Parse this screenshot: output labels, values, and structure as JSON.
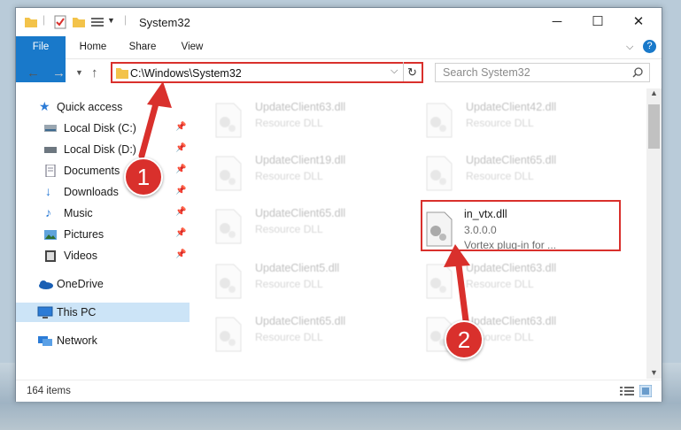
{
  "window": {
    "title": "System32",
    "controls": {
      "minimize": "─",
      "maximize": "☐",
      "close": "✕"
    }
  },
  "ribbon": {
    "tabs": [
      "File",
      "Home",
      "Share",
      "View"
    ],
    "expand_icon": "chevron-down-icon",
    "help_icon": "help-icon"
  },
  "address": {
    "path": "C:\\Windows\\System32",
    "search_placeholder": "Search System32"
  },
  "nav": {
    "items": [
      {
        "label": "Quick access",
        "icon": "star-icon",
        "pinned": false
      },
      {
        "label": "Local Disk (C:)",
        "icon": "drive-icon",
        "pinned": true
      },
      {
        "label": "Local Disk (D:)",
        "icon": "drive-icon",
        "pinned": true
      },
      {
        "label": "Documents",
        "icon": "document-icon",
        "pinned": true
      },
      {
        "label": "Downloads",
        "icon": "download-icon",
        "pinned": true
      },
      {
        "label": "Music",
        "icon": "music-icon",
        "pinned": true
      },
      {
        "label": "Pictures",
        "icon": "picture-icon",
        "pinned": true
      },
      {
        "label": "Videos",
        "icon": "video-icon",
        "pinned": true
      },
      {
        "label": "OneDrive",
        "icon": "cloud-icon",
        "pinned": false
      },
      {
        "label": "This PC",
        "icon": "computer-icon",
        "pinned": false,
        "selected": true
      },
      {
        "label": "Network",
        "icon": "network-icon",
        "pinned": false
      }
    ]
  },
  "files": [
    {
      "name": "UpdateClient63.dll",
      "desc": "Resource DLL"
    },
    {
      "name": "UpdateClient42.dll",
      "desc": "Resource DLL"
    },
    {
      "name": "UpdateClient19.dll",
      "desc": "Resource DLL"
    },
    {
      "name": "UpdateClient65.dll",
      "desc": "Resource DLL"
    },
    {
      "name": "UpdateClient65.dll",
      "desc": "Resource DLL"
    },
    {
      "name": "in_vtx.dll",
      "desc": "3.0.0.0",
      "desc2": "Vortex plug-in for ..."
    },
    {
      "name": "UpdateClient5.dll",
      "desc": "Resource DLL"
    },
    {
      "name": "UpdateClient63.dll",
      "desc": "Resource DLL"
    },
    {
      "name": "UpdateClient65.dll",
      "desc": "Resource DLL"
    },
    {
      "name": "UpdateClient63.dll",
      "desc": "Resource DLL"
    }
  ],
  "status": {
    "items_count": "164 items"
  },
  "annotations": {
    "step1": "1",
    "step2": "2",
    "color": "#d9302c"
  }
}
